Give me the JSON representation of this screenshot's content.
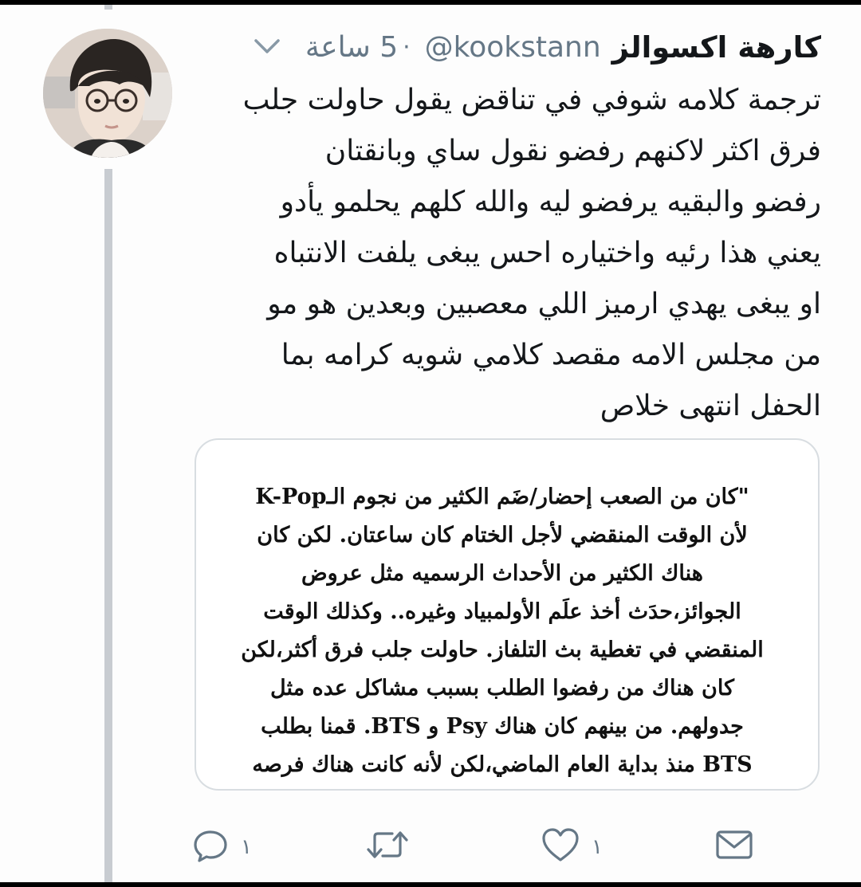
{
  "tweet": {
    "display_name": "كارهة اكسوالز",
    "handle": "@kookstann",
    "separator": "·",
    "time": "5 ساعة",
    "icons": {
      "menu": "chevron-down-icon",
      "reply": "reply-icon",
      "retweet": "retweet-icon",
      "like": "heart-icon",
      "share": "envelope-icon"
    },
    "text_lines": [
      "ترجمة كلامه شوفي في تناقض يقول حاولت جلب",
      "فرق اكثر لاكنهم رفضو نقول ساي وبانقتان",
      "رفضو والبقيه يرفضو ليه والله كلهم يحلمو يأدو",
      "يعني هذا رئيه واختياره احس يبغى يلفت الانتباه",
      "او يبغى يهدي ارميز اللي معصبين وبعدين هو مو",
      "من مجلس الامه مقصد كلامي شويه كرامه بما",
      "الحفل انتهى خلاص"
    ],
    "card_lines": [
      "\"كان من الصعب إحضار/ضَم الكثير من نجوم الـK-Pop",
      "لأن الوقت المنقضي لأجل الختام كان ساعتان. لكن كان",
      "هناك الكثير من الأحداث الرسميه مثل عروض",
      "الجوائز،حدَث أخذ علَم الأولمبياد وغيره.. وكذلك الوقت",
      "المنقضي في تغطية بث التلفاز. حاولت جلب فرق أكثر،لكن",
      "كان هناك من رفضوا الطلب بسبب مشاكل عده مثل",
      "جدولهم. من بينهم كان هناك Psy و BTS. قمنا بطلب",
      "BTS منذ بداية العام الماضي،لكن لأنه كانت هناك فرصه"
    ],
    "counts": {
      "reply": "١",
      "retweet": "",
      "like": "١",
      "share": ""
    },
    "colors": {
      "text": "#14171a",
      "secondary": "#657786",
      "border": "#d8dde1",
      "thread": "#c8ccd1"
    }
  }
}
